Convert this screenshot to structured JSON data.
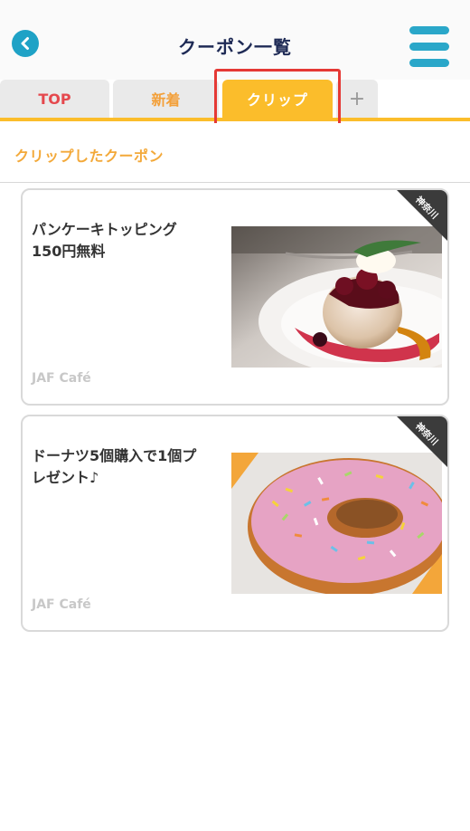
{
  "header": {
    "title": "クーポン一覧"
  },
  "tabs": [
    {
      "label": "TOP"
    },
    {
      "label": "新着"
    },
    {
      "label": "クリップ"
    },
    {
      "label": "+"
    }
  ],
  "section": {
    "title": "クリップしたクーポン"
  },
  "coupons": [
    {
      "line1": "パンケーキトッピング",
      "line2": "150円無料",
      "shop": "JAF Café",
      "region": "神奈川",
      "image": "pancake-image"
    },
    {
      "line1": "ドーナツ5個購入で1個プ",
      "line2": "レゼント♪",
      "shop": "JAF Café",
      "region": "神奈川",
      "image": "donut-image"
    }
  ],
  "colors": {
    "accent": "#fbbd2b",
    "brand_blue": "#1fa2c6",
    "tab_top_red": "#e5484d",
    "highlight_red": "#e53935"
  }
}
